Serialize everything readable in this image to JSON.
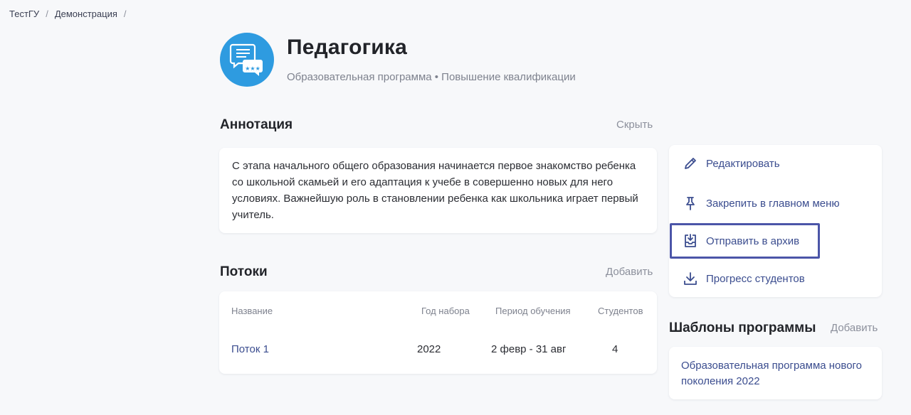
{
  "breadcrumb": {
    "items": [
      "ТестГУ",
      "Демонстрация"
    ],
    "separator": "/"
  },
  "program": {
    "title": "Педагогика",
    "subtitle": "Образовательная программа • Повышение квалификации",
    "icon": "chat-bubbles-icon"
  },
  "annotation": {
    "heading": "Аннотация",
    "hide_label": "Скрыть",
    "text": "С этапа начального общего образования начинается первое знакомство ребенка со школьной скамьей и его адаптация к учебе в совершенно новых для него условиях. Важнейшую роль в становлении ребенка как школьника играет первый учитель."
  },
  "streams": {
    "heading": "Потоки",
    "add_label": "Добавить",
    "columns": [
      "Название",
      "Год набора",
      "Период обучения",
      "Студентов"
    ],
    "rows": [
      {
        "name": "Поток 1",
        "year": "2022",
        "period": "2 февр - 31 авг",
        "students": "4"
      }
    ]
  },
  "actions": {
    "items": [
      {
        "label": "Редактировать",
        "icon": "pencil-icon"
      },
      {
        "label": "Закрепить в главном меню",
        "icon": "pin-icon"
      },
      {
        "label": "Отправить в архив",
        "icon": "archive-icon"
      },
      {
        "label": "Прогресс студентов",
        "icon": "download-icon"
      }
    ]
  },
  "templates": {
    "heading": "Шаблоны программы",
    "add_label": "Добавить",
    "items": [
      "Образовательная программа нового поколения 2022"
    ]
  },
  "colors": {
    "accent": "#3b4d8f",
    "logo": "#2e9be0",
    "highlight_border": "#4b55a8",
    "background": "#f7f8fa"
  }
}
